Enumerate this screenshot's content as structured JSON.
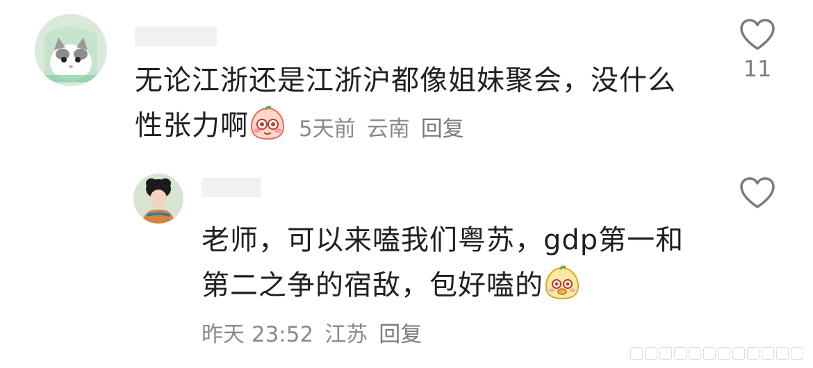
{
  "comments": [
    {
      "text_line1": "无论江浙还是江浙沪都像姐妹聚会，没什么",
      "text_line2": "性张力啊",
      "time": "5天前",
      "location": "云南",
      "reply_label": "回复",
      "like_count": "11",
      "emoji_name": "shy-peach-emoji",
      "like_icon": "heart-outline-icon"
    },
    {
      "text_line1": "老师，可以来嗑我们粤苏，gdp第一和",
      "text_line2": "第二之争的宿敌，包好嗑的",
      "time": "昨天 23:52",
      "location": "江苏",
      "reply_label": "回复",
      "like_count": "",
      "emoji_name": "sly-peach-emoji",
      "like_icon": "heart-outline-icon"
    }
  ],
  "colors": {
    "text": "#1f1f1f",
    "meta": "#8a8a8a",
    "icon": "#7a7a7a"
  }
}
